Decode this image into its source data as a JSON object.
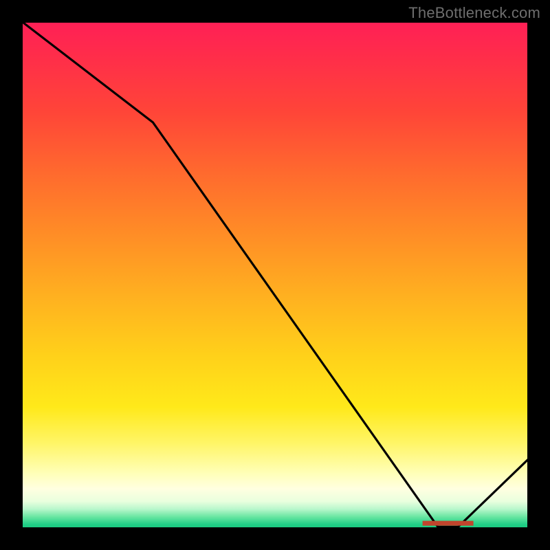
{
  "watermark": "TheBottleneck.com",
  "chart_data": {
    "type": "line",
    "title": "",
    "xlabel": "",
    "ylabel": "",
    "xlim": [
      0,
      100
    ],
    "ylim": [
      0,
      100
    ],
    "grid": false,
    "legend": false,
    "series": [
      {
        "name": "curve",
        "x": [
          0,
          26,
          82,
          86,
          100
        ],
        "values": [
          100,
          80,
          0.5,
          0.5,
          14
        ]
      }
    ],
    "marker": {
      "name": "minimum-band",
      "x_start": 79,
      "x_end": 89,
      "y": 1.2,
      "color": "#c1452d"
    },
    "gradient_stops": [
      {
        "pos": 0.0,
        "color": "#ff1f56"
      },
      {
        "pos": 0.3,
        "color": "#ff6a2e"
      },
      {
        "pos": 0.66,
        "color": "#ffd11a"
      },
      {
        "pos": 0.9,
        "color": "#ffffe0"
      },
      {
        "pos": 1.0,
        "color": "#16c77d"
      }
    ]
  }
}
